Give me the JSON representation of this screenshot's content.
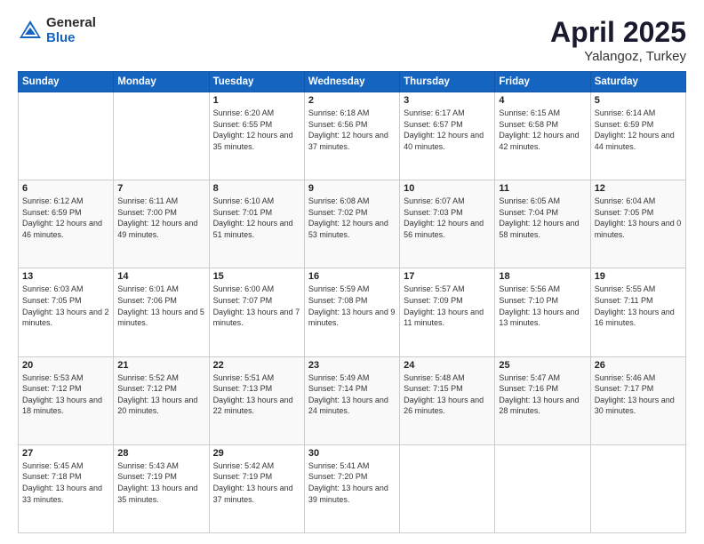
{
  "header": {
    "logo_general": "General",
    "logo_blue": "Blue",
    "title": "April 2025",
    "location": "Yalangoz, Turkey"
  },
  "days_of_week": [
    "Sunday",
    "Monday",
    "Tuesday",
    "Wednesday",
    "Thursday",
    "Friday",
    "Saturday"
  ],
  "weeks": [
    [
      {
        "day": null
      },
      {
        "day": null
      },
      {
        "day": "1",
        "sunrise": "6:20 AM",
        "sunset": "6:55 PM",
        "daylight": "12 hours and 35 minutes."
      },
      {
        "day": "2",
        "sunrise": "6:18 AM",
        "sunset": "6:56 PM",
        "daylight": "12 hours and 37 minutes."
      },
      {
        "day": "3",
        "sunrise": "6:17 AM",
        "sunset": "6:57 PM",
        "daylight": "12 hours and 40 minutes."
      },
      {
        "day": "4",
        "sunrise": "6:15 AM",
        "sunset": "6:58 PM",
        "daylight": "12 hours and 42 minutes."
      },
      {
        "day": "5",
        "sunrise": "6:14 AM",
        "sunset": "6:59 PM",
        "daylight": "12 hours and 44 minutes."
      }
    ],
    [
      {
        "day": "6",
        "sunrise": "6:12 AM",
        "sunset": "6:59 PM",
        "daylight": "12 hours and 46 minutes."
      },
      {
        "day": "7",
        "sunrise": "6:11 AM",
        "sunset": "7:00 PM",
        "daylight": "12 hours and 49 minutes."
      },
      {
        "day": "8",
        "sunrise": "6:10 AM",
        "sunset": "7:01 PM",
        "daylight": "12 hours and 51 minutes."
      },
      {
        "day": "9",
        "sunrise": "6:08 AM",
        "sunset": "7:02 PM",
        "daylight": "12 hours and 53 minutes."
      },
      {
        "day": "10",
        "sunrise": "6:07 AM",
        "sunset": "7:03 PM",
        "daylight": "12 hours and 56 minutes."
      },
      {
        "day": "11",
        "sunrise": "6:05 AM",
        "sunset": "7:04 PM",
        "daylight": "12 hours and 58 minutes."
      },
      {
        "day": "12",
        "sunrise": "6:04 AM",
        "sunset": "7:05 PM",
        "daylight": "13 hours and 0 minutes."
      }
    ],
    [
      {
        "day": "13",
        "sunrise": "6:03 AM",
        "sunset": "7:05 PM",
        "daylight": "13 hours and 2 minutes."
      },
      {
        "day": "14",
        "sunrise": "6:01 AM",
        "sunset": "7:06 PM",
        "daylight": "13 hours and 5 minutes."
      },
      {
        "day": "15",
        "sunrise": "6:00 AM",
        "sunset": "7:07 PM",
        "daylight": "13 hours and 7 minutes."
      },
      {
        "day": "16",
        "sunrise": "5:59 AM",
        "sunset": "7:08 PM",
        "daylight": "13 hours and 9 minutes."
      },
      {
        "day": "17",
        "sunrise": "5:57 AM",
        "sunset": "7:09 PM",
        "daylight": "13 hours and 11 minutes."
      },
      {
        "day": "18",
        "sunrise": "5:56 AM",
        "sunset": "7:10 PM",
        "daylight": "13 hours and 13 minutes."
      },
      {
        "day": "19",
        "sunrise": "5:55 AM",
        "sunset": "7:11 PM",
        "daylight": "13 hours and 16 minutes."
      }
    ],
    [
      {
        "day": "20",
        "sunrise": "5:53 AM",
        "sunset": "7:12 PM",
        "daylight": "13 hours and 18 minutes."
      },
      {
        "day": "21",
        "sunrise": "5:52 AM",
        "sunset": "7:12 PM",
        "daylight": "13 hours and 20 minutes."
      },
      {
        "day": "22",
        "sunrise": "5:51 AM",
        "sunset": "7:13 PM",
        "daylight": "13 hours and 22 minutes."
      },
      {
        "day": "23",
        "sunrise": "5:49 AM",
        "sunset": "7:14 PM",
        "daylight": "13 hours and 24 minutes."
      },
      {
        "day": "24",
        "sunrise": "5:48 AM",
        "sunset": "7:15 PM",
        "daylight": "13 hours and 26 minutes."
      },
      {
        "day": "25",
        "sunrise": "5:47 AM",
        "sunset": "7:16 PM",
        "daylight": "13 hours and 28 minutes."
      },
      {
        "day": "26",
        "sunrise": "5:46 AM",
        "sunset": "7:17 PM",
        "daylight": "13 hours and 30 minutes."
      }
    ],
    [
      {
        "day": "27",
        "sunrise": "5:45 AM",
        "sunset": "7:18 PM",
        "daylight": "13 hours and 33 minutes."
      },
      {
        "day": "28",
        "sunrise": "5:43 AM",
        "sunset": "7:19 PM",
        "daylight": "13 hours and 35 minutes."
      },
      {
        "day": "29",
        "sunrise": "5:42 AM",
        "sunset": "7:19 PM",
        "daylight": "13 hours and 37 minutes."
      },
      {
        "day": "30",
        "sunrise": "5:41 AM",
        "sunset": "7:20 PM",
        "daylight": "13 hours and 39 minutes."
      },
      {
        "day": null
      },
      {
        "day": null
      },
      {
        "day": null
      }
    ]
  ]
}
